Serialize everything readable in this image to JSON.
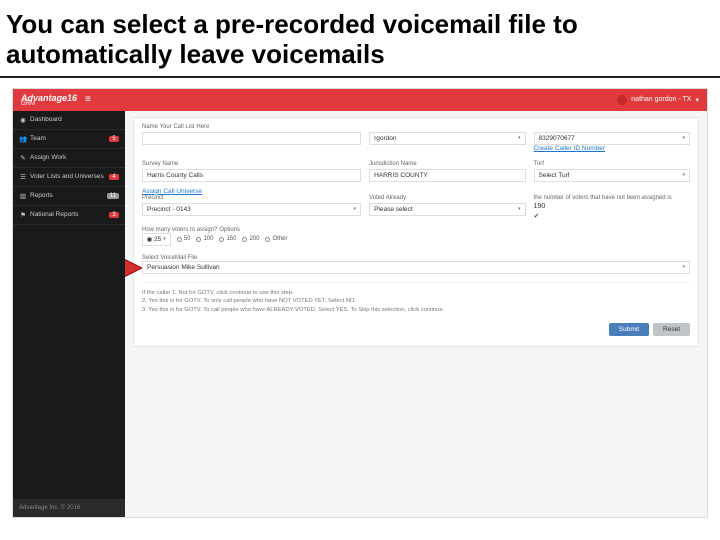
{
  "slide": {
    "title": "You can select a pre-recorded voicemail file to automatically leave voicemails"
  },
  "header": {
    "brand": "Advantage16",
    "brand_sub": "GRM",
    "user": "nathan gordon - TX"
  },
  "sidebar": {
    "items": [
      {
        "icon": "speed",
        "label": "Dashboard",
        "badge": ""
      },
      {
        "icon": "users",
        "label": "Team",
        "badge": "5"
      },
      {
        "icon": "pencil",
        "label": "Assign Work",
        "badge": ""
      },
      {
        "icon": "list",
        "label": "Voter Lists and Universes",
        "badge": "4"
      },
      {
        "icon": "chart",
        "label": "Reports",
        "badge": "11"
      },
      {
        "icon": "flag",
        "label": "National Reports",
        "badge": "3"
      }
    ],
    "footer": "Advantage Inc. © 2016"
  },
  "form": {
    "name_label": "Name Your Call List Here",
    "name_value": "",
    "user_label": "",
    "user_value": "rgordon",
    "callerid_value": "8329070677",
    "callerid_link": "Create Caller ID Number",
    "survey_label": "Survey Name",
    "survey_value": "Harris County Calls",
    "jurisdiction_label": "Jurisdiction Name",
    "jurisdiction_value": "HARRIS COUNTY",
    "turf_label": "Turf",
    "turf_value": "Select Turf",
    "assign_link": "Assign Call Universe",
    "precinct_label": "Precinct",
    "precinct_value": "Precinct - 0143",
    "voted_label": "Voted Already",
    "voted_value": "Please select",
    "unassigned_label": "the number of voters that have not been assigned is",
    "unassigned_value": "190",
    "howmany_label": "How many voters to assign?",
    "options_label": "Options",
    "selected_opt": "25",
    "opts": [
      "50",
      "100",
      "150",
      "200",
      "Other"
    ],
    "vm_label": "Select VoiceMail File",
    "vm_value": "Persuasion Mike Sullivan",
    "note1": "If the caller 1. Not for GOTV, click continue to use this step.",
    "note2": "2. Yes this is for GOTV. To only call people who have NOT VOTED YET, Select NO.",
    "note3": "3. Yes this is for GOTV. To call people who have ALREADY VOTED. Select YES. To Skip this selection, click continue.",
    "submit": "Submit",
    "reset": "Reset"
  }
}
